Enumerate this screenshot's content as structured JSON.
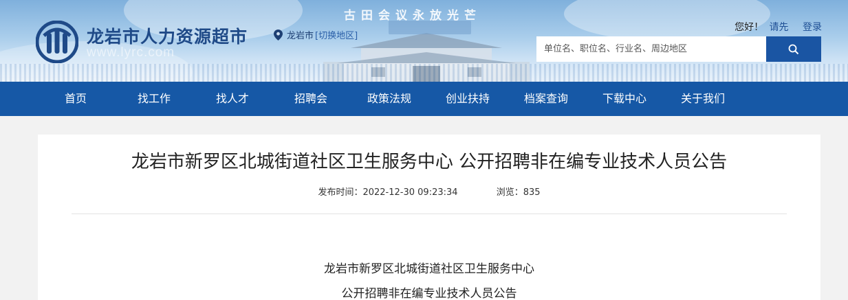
{
  "header": {
    "site_title": "龙岩市人力资源超市",
    "site_url": "www.lyrc.com",
    "banner_text": "古田会议永放光芒",
    "location": {
      "city": "龙岩市",
      "switch_label": "[切换地区]"
    },
    "userbar": {
      "greeting": "您好！",
      "login_label": "请先",
      "login_link": "登录"
    },
    "search": {
      "placeholder": "单位名、职位名、行业名、周边地区",
      "button_icon": "search-icon"
    }
  },
  "nav": {
    "items": [
      {
        "label": "首页"
      },
      {
        "label": "找工作"
      },
      {
        "label": "找人才"
      },
      {
        "label": "招聘会"
      },
      {
        "label": "政策法规"
      },
      {
        "label": "创业扶持"
      },
      {
        "label": "档案查询"
      },
      {
        "label": "下载中心"
      },
      {
        "label": "关于我们"
      }
    ]
  },
  "article": {
    "title": "龙岩市新罗区北城街道社区卫生服务中心 公开招聘非在编专业技术人员公告",
    "published_label": "发布时间：",
    "published_value": "2022-12-30 09:23:34",
    "views_label": "浏览：",
    "views_value": "835",
    "body": [
      "龙岩市新罗区北城街道社区卫生服务中心",
      "公开招聘非在编专业技术人员公告"
    ]
  },
  "colors": {
    "nav_bg": "#1658a6",
    "search_button": "#1a55a3",
    "title_brand": "#1f4a88",
    "page_bg": "#f2f2f2"
  }
}
